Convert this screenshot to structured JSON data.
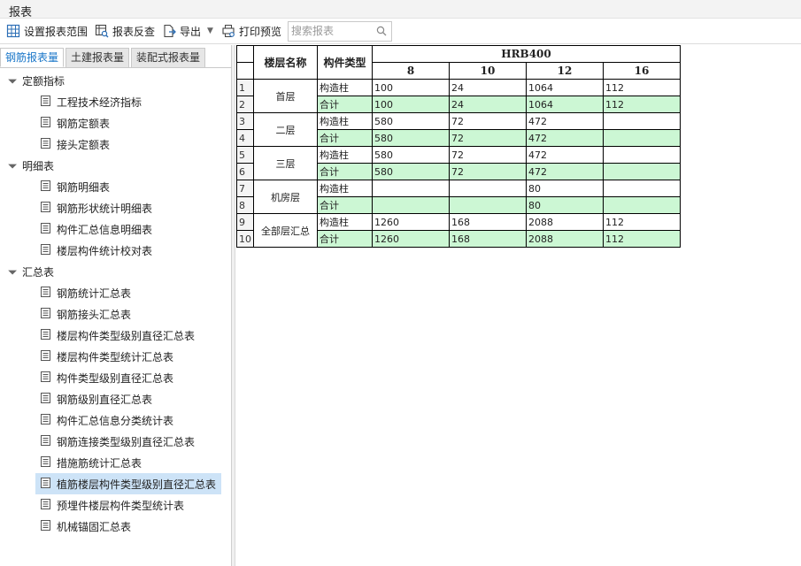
{
  "window": {
    "title": "报表"
  },
  "toolbar": {
    "set_range": "设置报表范围",
    "reverse_check": "报表反查",
    "export": "导出",
    "print_preview": "打印预览",
    "search_placeholder": "搜索报表"
  },
  "tabs": [
    {
      "label": "钢筋报表量",
      "active": true
    },
    {
      "label": "土建报表量",
      "active": false
    },
    {
      "label": "装配式报表量",
      "active": false
    }
  ],
  "tree": [
    {
      "group": "定额指标",
      "items": [
        "工程技术经济指标",
        "钢筋定额表",
        "接头定额表"
      ]
    },
    {
      "group": "明细表",
      "items": [
        "钢筋明细表",
        "钢筋形状统计明细表",
        "构件汇总信息明细表",
        "楼层构件统计校对表"
      ]
    },
    {
      "group": "汇总表",
      "items": [
        "钢筋统计汇总表",
        "钢筋接头汇总表",
        "楼层构件类型级别直径汇总表",
        "楼层构件类型统计汇总表",
        "构件类型级别直径汇总表",
        "钢筋级别直径汇总表",
        "构件汇总信息分类统计表",
        "钢筋连接类型级别直径汇总表",
        "措施筋统计汇总表",
        "植筋楼层构件类型级别直径汇总表",
        "预埋件楼层构件类型统计表",
        "机械锚固汇总表"
      ]
    }
  ],
  "selected_item": "植筋楼层构件类型级别直径汇总表",
  "report": {
    "col_floor": "楼层名称",
    "col_type": "构件类型",
    "grade": "HRB400",
    "diameters": [
      "8",
      "10",
      "12",
      "16"
    ],
    "row_numbers": [
      "1",
      "2",
      "3",
      "4",
      "5",
      "6",
      "7",
      "8",
      "9",
      "10"
    ],
    "floors": [
      {
        "name": "首层",
        "rows": [
          {
            "type": "构造柱",
            "values": [
              "100",
              "24",
              "1064",
              "112"
            ]
          },
          {
            "type": "合计",
            "values": [
              "100",
              "24",
              "1064",
              "112"
            ]
          }
        ]
      },
      {
        "name": "二层",
        "rows": [
          {
            "type": "构造柱",
            "values": [
              "580",
              "72",
              "472",
              ""
            ]
          },
          {
            "type": "合计",
            "values": [
              "580",
              "72",
              "472",
              ""
            ]
          }
        ]
      },
      {
        "name": "三层",
        "rows": [
          {
            "type": "构造柱",
            "values": [
              "580",
              "72",
              "472",
              ""
            ]
          },
          {
            "type": "合计",
            "values": [
              "580",
              "72",
              "472",
              ""
            ]
          }
        ]
      },
      {
        "name": "机房层",
        "rows": [
          {
            "type": "构造柱",
            "values": [
              "",
              "",
              "80",
              ""
            ]
          },
          {
            "type": "合计",
            "values": [
              "",
              "",
              "80",
              ""
            ]
          }
        ]
      },
      {
        "name": "全部层汇总",
        "rows": [
          {
            "type": "构造柱",
            "values": [
              "1260",
              "168",
              "2088",
              "112"
            ]
          },
          {
            "type": "合计",
            "values": [
              "1260",
              "168",
              "2088",
              "112"
            ]
          }
        ]
      }
    ]
  },
  "colors": {
    "total_row": "#ccf7d4",
    "selected": "#cde3f7",
    "active_tab": "#1976c8"
  }
}
